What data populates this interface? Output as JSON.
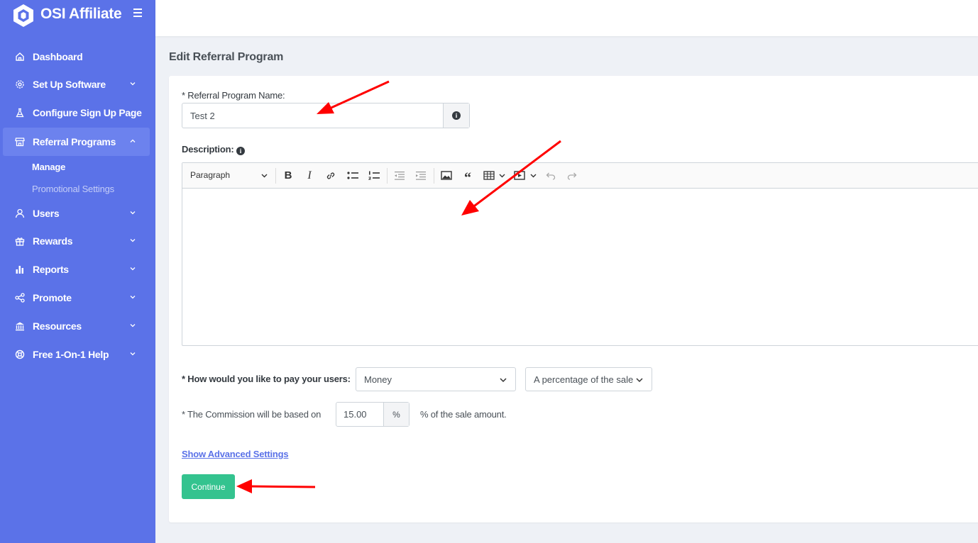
{
  "brand": {
    "name": "OSI Affiliate"
  },
  "sidebar": {
    "items": [
      {
        "label": "Dashboard",
        "icon": "home-icon"
      },
      {
        "label": "Set Up Software",
        "icon": "settings-icon"
      },
      {
        "label": "Configure Sign Up Page",
        "icon": "flask-icon"
      },
      {
        "label": "Referral Programs",
        "icon": "store-icon"
      },
      {
        "label": "Users",
        "icon": "user-icon"
      },
      {
        "label": "Rewards",
        "icon": "gift-icon"
      },
      {
        "label": "Reports",
        "icon": "bar-chart-icon"
      },
      {
        "label": "Promote",
        "icon": "share-icon"
      },
      {
        "label": "Resources",
        "icon": "bank-icon"
      },
      {
        "label": "Free 1-On-1 Help",
        "icon": "lifebuoy-icon"
      }
    ],
    "submenu": [
      {
        "label": "Manage"
      },
      {
        "label": "Promotional Settings"
      }
    ]
  },
  "page": {
    "title": "Edit Referral Program"
  },
  "form": {
    "name_label": "* Referral Program Name:",
    "name_value": "Test 2",
    "description_label": "Description:",
    "editor": {
      "paragraph_label": "Paragraph",
      "content": ""
    },
    "pay_label": "* How would you like to pay your users:",
    "pay_method": "Money",
    "pay_basis": "A percentage of the sale",
    "commission_label": "* The Commission will be based on",
    "commission_value": "15.00",
    "commission_unit": "%",
    "commission_suffix": "% of the sale amount.",
    "advanced_link": "Show Advanced Settings",
    "continue_label": "Continue"
  },
  "colors": {
    "sidebar": "#5b72e8",
    "active_item": "#6c82ee",
    "primary_button": "#34c38f",
    "link": "#5b72e8",
    "annotation_arrow": "#ff0000"
  }
}
